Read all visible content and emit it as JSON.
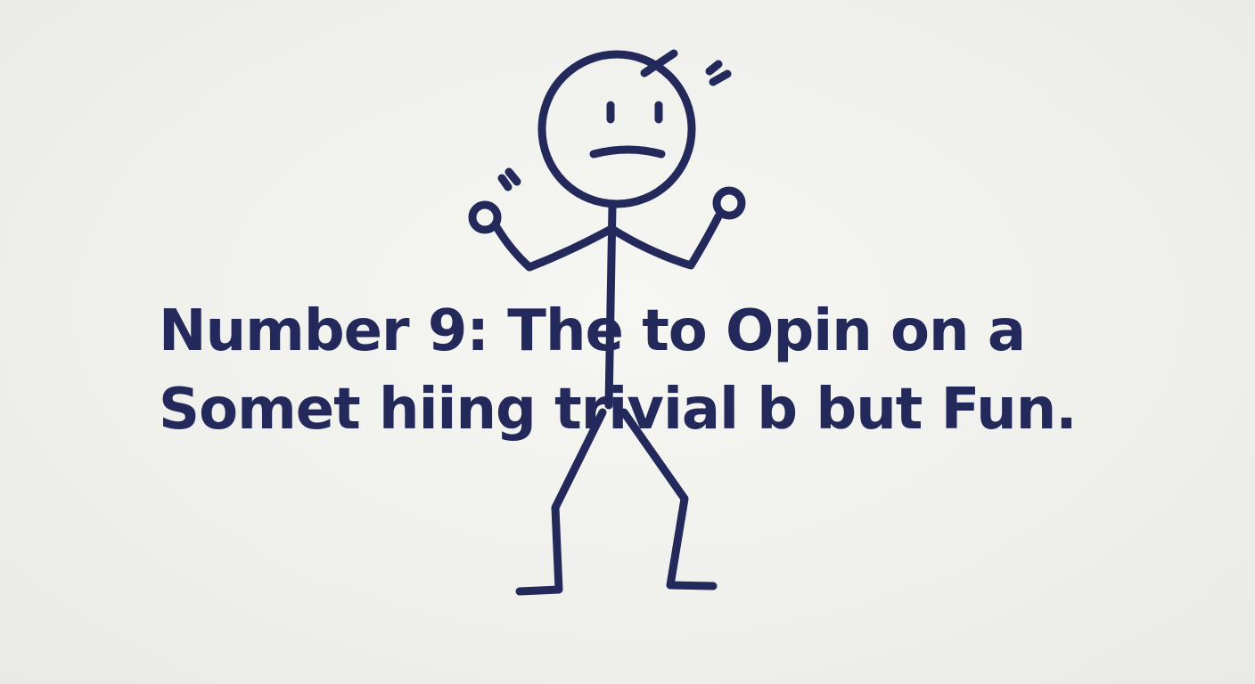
{
  "caption": {
    "line1": "Number  9: The to Opin on a",
    "line2": "Somet hiing trivial b but Fun."
  },
  "colors": {
    "background": "#f1f1ee",
    "ink": "#23295a"
  },
  "illustration": {
    "subject": "stick-figure",
    "expression": "frowning",
    "pose": "arms-raised-fists"
  }
}
